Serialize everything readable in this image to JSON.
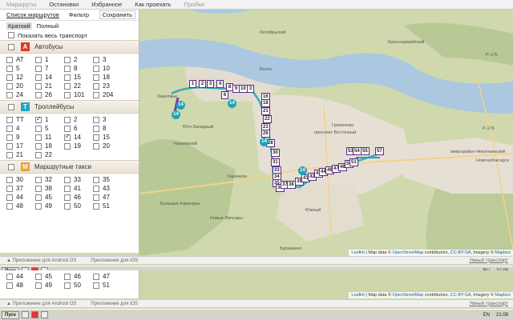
{
  "topnav": {
    "tabs": [
      "Маршруты",
      "Остановки",
      "Избранное",
      "Как проехать",
      "Пробки"
    ]
  },
  "panel": {
    "subtabs": {
      "list": "Список маршрутов",
      "filter": "Фильтр",
      "save": "Сохранить"
    },
    "modes": {
      "short": "Краткий",
      "full": "Полный"
    },
    "show_all": "Показать весь транспорт",
    "sections": [
      {
        "badge": "A",
        "badge_color": "#d63a2a",
        "title": "Автобусы",
        "routes": [
          {
            "n": "AT",
            "on": false
          },
          {
            "n": "1",
            "on": false
          },
          {
            "n": "2",
            "on": false
          },
          {
            "n": "3",
            "on": false
          },
          {
            "n": "5",
            "on": false
          },
          {
            "n": "7",
            "on": false
          },
          {
            "n": "8",
            "on": false
          },
          {
            "n": "10",
            "on": false
          },
          {
            "n": "12",
            "on": false
          },
          {
            "n": "14",
            "on": false
          },
          {
            "n": "15",
            "on": false
          },
          {
            "n": "18",
            "on": false
          },
          {
            "n": "20",
            "on": false
          },
          {
            "n": "21",
            "on": false
          },
          {
            "n": "22",
            "on": false
          },
          {
            "n": "23",
            "on": false
          },
          {
            "n": "24",
            "on": false
          },
          {
            "n": "26",
            "on": false
          },
          {
            "n": "101",
            "on": false
          },
          {
            "n": "204",
            "on": false
          }
        ]
      },
      {
        "badge": "T",
        "badge_color": "#23a6c4",
        "title": "Троллейбусы",
        "routes": [
          {
            "n": "TT",
            "on": false
          },
          {
            "n": "1",
            "on": true
          },
          {
            "n": "2",
            "on": false
          },
          {
            "n": "3",
            "on": false
          },
          {
            "n": "4",
            "on": false
          },
          {
            "n": "5",
            "on": false
          },
          {
            "n": "6",
            "on": false
          },
          {
            "n": "8",
            "on": false
          },
          {
            "n": "9",
            "on": false
          },
          {
            "n": "11",
            "on": false
          },
          {
            "n": "14",
            "on": true
          },
          {
            "n": "15",
            "on": false
          },
          {
            "n": "17",
            "on": false
          },
          {
            "n": "18",
            "on": false
          },
          {
            "n": "19",
            "on": false
          },
          {
            "n": "20",
            "on": false
          },
          {
            "n": "21",
            "on": false
          },
          {
            "n": "22",
            "on": false
          }
        ]
      },
      {
        "badge": "M",
        "badge_color": "#e8a23a",
        "title": "Маршрутные такси",
        "routes": [
          {
            "n": "30",
            "on": false
          },
          {
            "n": "32",
            "on": false
          },
          {
            "n": "33",
            "on": false
          },
          {
            "n": "35",
            "on": false
          },
          {
            "n": "37",
            "on": false
          },
          {
            "n": "38",
            "on": false
          },
          {
            "n": "41",
            "on": false
          },
          {
            "n": "43",
            "on": false
          },
          {
            "n": "44",
            "on": false
          },
          {
            "n": "45",
            "on": false
          },
          {
            "n": "46",
            "on": false
          },
          {
            "n": "47",
            "on": false
          },
          {
            "n": "48",
            "on": false
          },
          {
            "n": "49",
            "on": false
          },
          {
            "n": "50",
            "on": false
          },
          {
            "n": "51",
            "on": false
          }
        ]
      }
    ]
  },
  "low_panel": {
    "routes": [
      {
        "n": "44",
        "on": false
      },
      {
        "n": "45",
        "on": false
      },
      {
        "n": "46",
        "on": false
      },
      {
        "n": "47",
        "on": false
      },
      {
        "n": "48",
        "on": false
      },
      {
        "n": "49",
        "on": false
      },
      {
        "n": "50",
        "on": false
      },
      {
        "n": "51",
        "on": false
      }
    ]
  },
  "map": {
    "labels": {
      "volga": "Волга",
      "oktyabrsky": "Октябрьский",
      "zavolzhye": "Заволжье",
      "gremyachevo": "Гремячево",
      "yugo_zapadny": "Юго-Западный",
      "chapaevsky": "Чапаевский",
      "karachikha": "Карачиха",
      "yuzhny": "Южный",
      "burmakino": "Бурмакино",
      "nov_lapsary": "Новые Лапсары",
      "bolsh_karachury": "Большие Карачуры",
      "mikrorayon": "микрорайон Николаевский",
      "novocheboksarsk": "Новочебоксарск",
      "r176a": "Р-176",
      "r176b": "Р-176",
      "krasnoyarsk": "Красноармейский",
      "prosp_vostochny": "проспект Восточный"
    },
    "stops": [
      "1",
      "2",
      "3",
      "4",
      "6",
      "8",
      "9",
      "10",
      "3",
      "16",
      "18",
      "21",
      "22",
      "23",
      "26",
      "28",
      "30",
      "31",
      "33",
      "34",
      "35",
      "36",
      "37",
      "38",
      "39",
      "41",
      "42",
      "43",
      "44",
      "46",
      "47",
      "48",
      "50",
      "51",
      "53",
      "54",
      "55",
      "57"
    ],
    "buses": [
      "14",
      "14",
      "14",
      "14",
      "14"
    ],
    "attribution": {
      "leaflet": "Leaflet",
      "rest": " | Map data © ",
      "osm": "OpenStreetMap",
      "rest2": " contributors, ",
      "cc": "CC-BY-SA",
      "rest3": ", Imagery © ",
      "mapbox": "Mapbox"
    }
  },
  "appbar": {
    "android": "Приложение для Android OS",
    "ios": "Приложение для iOS",
    "brand": "Умный транспорт"
  },
  "taskbar": {
    "start": "Пуск",
    "lang": "RU",
    "time": "21:08"
  },
  "taskbar2": {
    "lang": "EN",
    "time": "21:08"
  }
}
